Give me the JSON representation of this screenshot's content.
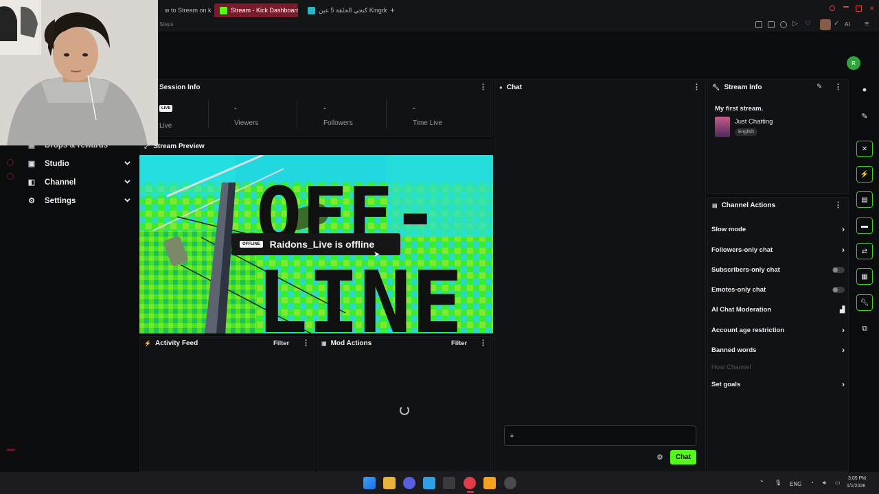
{
  "browser": {
    "tabs": [
      {
        "label": "w to Stream on k"
      },
      {
        "label": "Stream - Kick Dashboard"
      },
      {
        "label": "كنجي الحلقة 5 عين Kingdom"
      }
    ],
    "breadcrumb": "Steps",
    "colors": {
      "kick_green": "#53fc18",
      "active_tab": "#7a1a2a"
    }
  },
  "sidebar": {
    "items": [
      {
        "label": "Drops & rewards",
        "icon": "gift-icon"
      },
      {
        "label": "Studio",
        "icon": "monitor-icon"
      },
      {
        "label": "Channel",
        "icon": "channel-icon"
      },
      {
        "label": "Settings",
        "icon": "gear-icon"
      }
    ]
  },
  "session": {
    "title": "Session Info",
    "live_badge": "LIVE",
    "live_label": "Live",
    "stats": [
      {
        "value": "-",
        "label": "Viewers"
      },
      {
        "value": "-",
        "label": "Followers"
      },
      {
        "value": "-",
        "label": "Time Live"
      }
    ]
  },
  "preview": {
    "title": "Stream Preview",
    "overlay_text": "OFF- LINE",
    "offline_tag": "OFFLINE",
    "offline_message": "Raidons_Live is offline"
  },
  "activity_feed": {
    "title": "Activity Feed",
    "filter_label": "Filter"
  },
  "mod_actions": {
    "title": "Mod Actions",
    "filter_label": "Filter"
  },
  "chat": {
    "title": "Chat",
    "send_label": "Chat"
  },
  "stream_info": {
    "title": "Stream Info",
    "stream_title": "My first stream.",
    "category": "Just Chatting",
    "language": "English"
  },
  "channel_actions": {
    "title": "Channel Actions",
    "rows": [
      {
        "label": "Slow mode",
        "control": "chevron"
      },
      {
        "label": "Followers-only chat",
        "control": "chevron"
      },
      {
        "label": "Subscribers-only chat",
        "control": "toggle"
      },
      {
        "label": "Emotes-only chat",
        "control": "toggle"
      },
      {
        "label": "AI Chat Moderation",
        "control": "chart"
      },
      {
        "label": "Account age restriction",
        "control": "chevron"
      },
      {
        "label": "Banned words",
        "control": "chevron"
      },
      {
        "label": "Host Channel",
        "control": "none",
        "disabled": true
      },
      {
        "label": "Set goals",
        "control": "chevron"
      }
    ]
  },
  "taskbar": {
    "language": "ENG",
    "time": "3:05 PM",
    "date": "1/1/2026"
  }
}
